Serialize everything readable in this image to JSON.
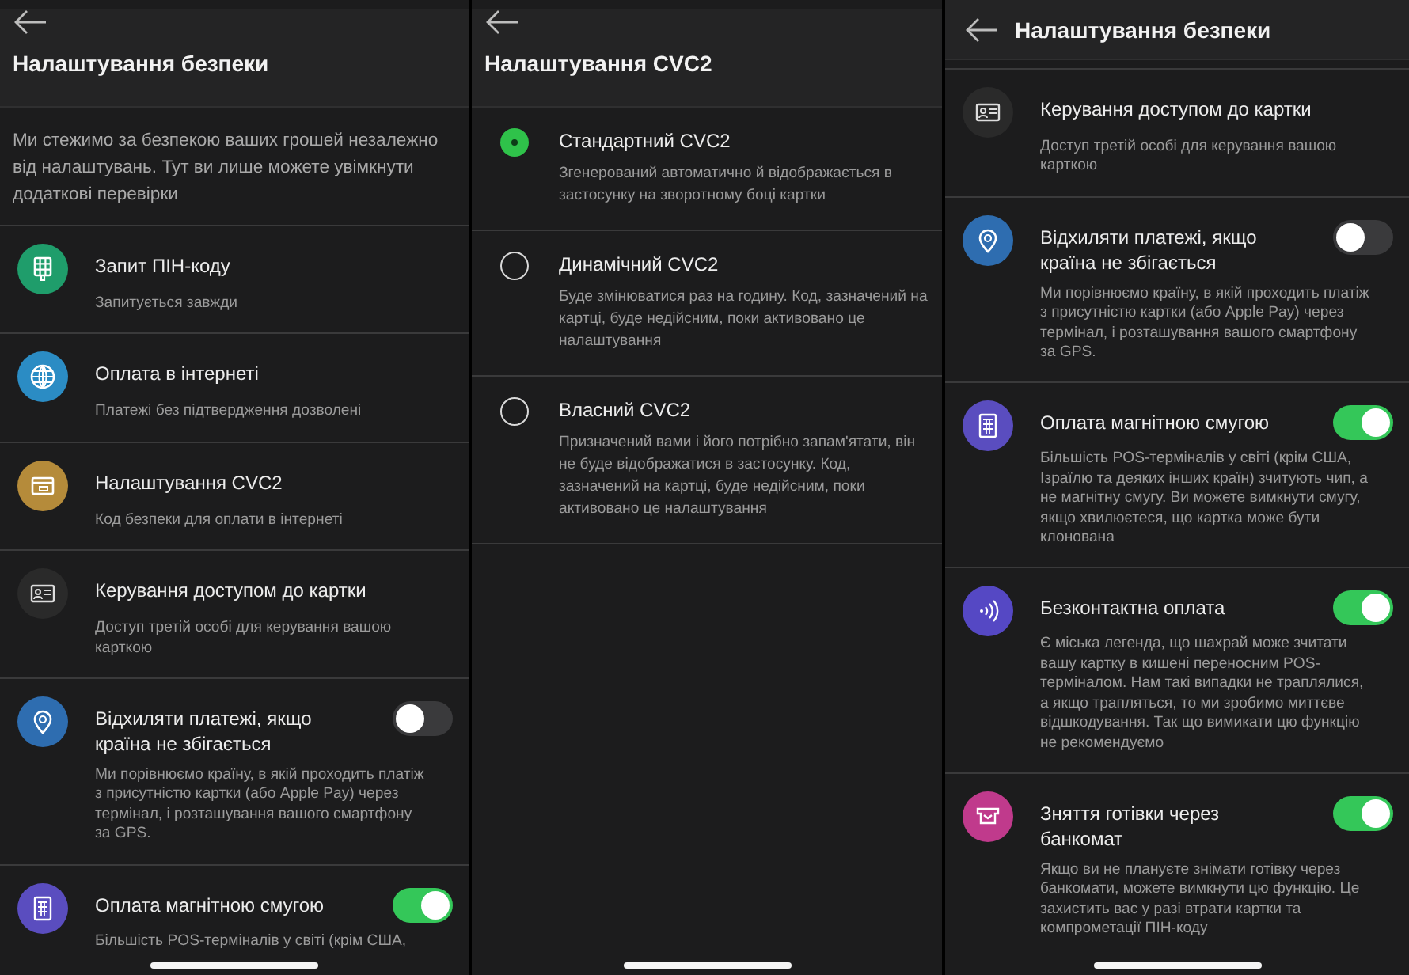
{
  "panels": [
    {
      "kind": "settings",
      "compact_header": false,
      "title": "Налаштування безпеки",
      "intro": "Ми стежимо за безпекою ваших грошей незалежно від налаштувань. Тут ви лише можете увімкнути додаткові перевірки",
      "items": [
        {
          "kind": "keypad",
          "color": "#1f9d6b",
          "title": "Запит ПІН-коду",
          "description": "Запитується завжди"
        },
        {
          "kind": "globe",
          "color": "#2b8cc4",
          "title": "Оплата в інтернеті",
          "description": "Платежі без підтвердження дозволені"
        },
        {
          "kind": "card",
          "color": "#b58b3a",
          "title": "Налаштування CVC2",
          "description": "Код безпеки для оплати в інтернеті"
        },
        {
          "kind": "id-card",
          "color": "#2a2a2a",
          "title": "Керування доступом до картки",
          "description": "Доступ третій особі для керування вашою карткою"
        },
        {
          "kind": "pin",
          "color": "#2e6db0",
          "title": "Відхиляти платежі, якщо країна не збігається",
          "description": "Ми порівнюємо країну, в якій проходить платіж з присутністю картки (або Apple Pay) через термінал, і розташування вашого смартфону за GPS.",
          "on": false
        },
        {
          "kind": "terminal",
          "color": "#5a4dbf",
          "title": "Оплата магнітною смугою",
          "description": "Більшість POS-терміналів у світі (крім США,",
          "on": true
        }
      ]
    },
    {
      "kind": "options",
      "compact_header": false,
      "title": "Налаштування CVC2",
      "options": [
        {
          "title": "Стандартний CVC2",
          "description": "Згенерований автоматично й відображається в застосунку на зворотному боці картки",
          "selected": true
        },
        {
          "title": "Динамічний CVC2",
          "description": "Буде змінюватися раз на годину. Код, зазначений на картці, буде недійсним, поки активовано це налаштування",
          "selected": false
        },
        {
          "title": "Власний CVC2",
          "description": "Призначений вами і його потрібно запам'ятати, він не буде відображатися в застосунку. Код, зазначений на картці, буде недійсним, поки активовано це налаштування",
          "selected": false
        }
      ]
    },
    {
      "kind": "settings",
      "compact_header": true,
      "title": "Налаштування безпеки",
      "items": [
        {
          "kind": "id-card",
          "color": "#2a2a2a",
          "title": "Керування доступом до картки",
          "description": "Доступ третій особі для керування вашою карткою"
        },
        {
          "kind": "pin",
          "color": "#2e6db0",
          "title": "Відхиляти платежі, якщо країна не збігається",
          "description": "Ми порівнюємо країну, в якій проходить платіж з присутністю картки (або Apple Pay) через термінал, і розташування вашого смартфону за GPS.",
          "on": false
        },
        {
          "kind": "terminal",
          "color": "#5a4dbf",
          "title": "Оплата магнітною смугою",
          "description": "Більшість POS-терміналів у світі (крім США, Ізраїлю та деяких інших країн) зчитують чип, а не магнітну смугу. Ви можете вимкнути смугу, якщо хвилюєтеся, що картка може бути клонована",
          "on": true
        },
        {
          "kind": "contactless",
          "color": "#5548c4",
          "title": "Безконтактна оплата",
          "description": "Є міська легенда, що шахрай може зчитати вашу картку в кишені переносним POS-терміналом. Нам такі випадки не траплялися, а якщо трапляться, то ми зробимо миттєве відшкодування. Так що вимикати цю функцію не рекомендуємо",
          "on": true
        },
        {
          "kind": "atm",
          "color": "#c03a8c",
          "title": "Зняття готівки через банкомат",
          "description": "Якщо ви не плануєте знімати готівку через банкомати, можете вимкнути цю функцію. Це захистить вас у разі втрати картки та компрометації ПІН-коду",
          "on": true
        }
      ]
    }
  ]
}
